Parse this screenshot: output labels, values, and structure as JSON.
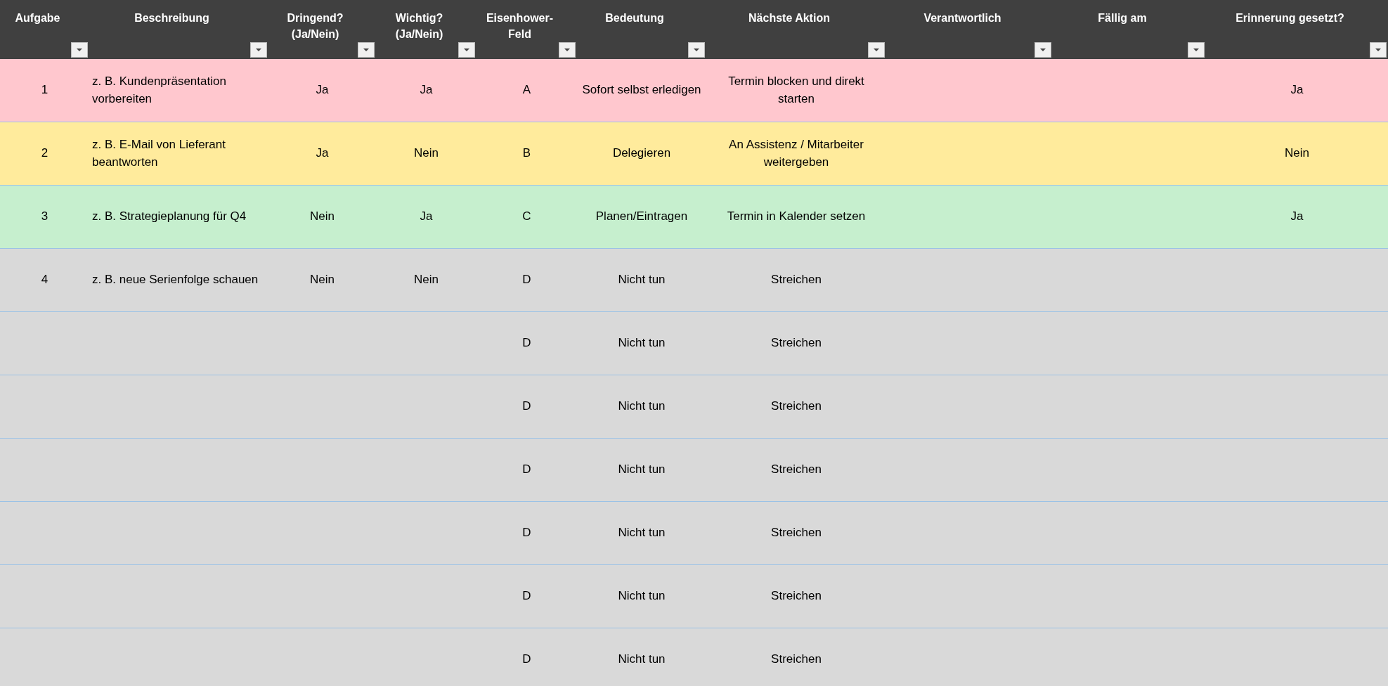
{
  "table": {
    "columns": [
      {
        "label": "Aufgabe"
      },
      {
        "label": "Beschreibung"
      },
      {
        "label": "Dringend? (Ja/Nein)"
      },
      {
        "label": "Wichtig? (Ja/Nein)"
      },
      {
        "label": "Eisenhower-Feld"
      },
      {
        "label": "Bedeutung"
      },
      {
        "label": "Nächste Aktion"
      },
      {
        "label": "Verantwortlich"
      },
      {
        "label": "Fällig am"
      },
      {
        "label": "Erinnerung gesetzt?"
      }
    ],
    "rows": [
      {
        "color": "#ffc7ce",
        "task": "1",
        "description": "z. B. Kundenpräsentation vorbereiten",
        "urgent": "Ja",
        "important": "Ja",
        "field": "A",
        "meaning": "Sofort selbst erledigen",
        "next_action": "Termin blocken und direkt starten",
        "reminder": "Ja"
      },
      {
        "color": "#ffeb9c",
        "task": "2",
        "description": "z. B. E-Mail von Lieferant beantworten",
        "urgent": "Ja",
        "important": "Nein",
        "field": "B",
        "meaning": "Delegieren",
        "next_action": "An Assistenz / Mitarbeiter weitergeben",
        "reminder": "Nein"
      },
      {
        "color": "#c6efce",
        "task": "3",
        "description": "z. B. Strategieplanung für Q4",
        "urgent": "Nein",
        "important": "Ja",
        "field": "C",
        "meaning": "Planen/Eintragen",
        "next_action": "Termin in Kalender setzen",
        "reminder": "Ja"
      },
      {
        "color": "#d9d9d9",
        "task": "4",
        "description": "z. B. neue Serienfolge schauen",
        "urgent": "Nein",
        "important": "Nein",
        "field": "D",
        "meaning": "Nicht tun",
        "next_action": "Streichen"
      },
      {
        "color": "#d9d9d9",
        "field": "D",
        "meaning": "Nicht tun",
        "next_action": "Streichen"
      },
      {
        "color": "#d9d9d9",
        "field": "D",
        "meaning": "Nicht tun",
        "next_action": "Streichen"
      },
      {
        "color": "#d9d9d9",
        "field": "D",
        "meaning": "Nicht tun",
        "next_action": "Streichen"
      },
      {
        "color": "#d9d9d9",
        "field": "D",
        "meaning": "Nicht tun",
        "next_action": "Streichen"
      },
      {
        "color": "#d9d9d9",
        "field": "D",
        "meaning": "Nicht tun",
        "next_action": "Streichen"
      },
      {
        "color": "#d9d9d9",
        "field": "D",
        "meaning": "Nicht tun",
        "next_action": "Streichen"
      }
    ]
  }
}
